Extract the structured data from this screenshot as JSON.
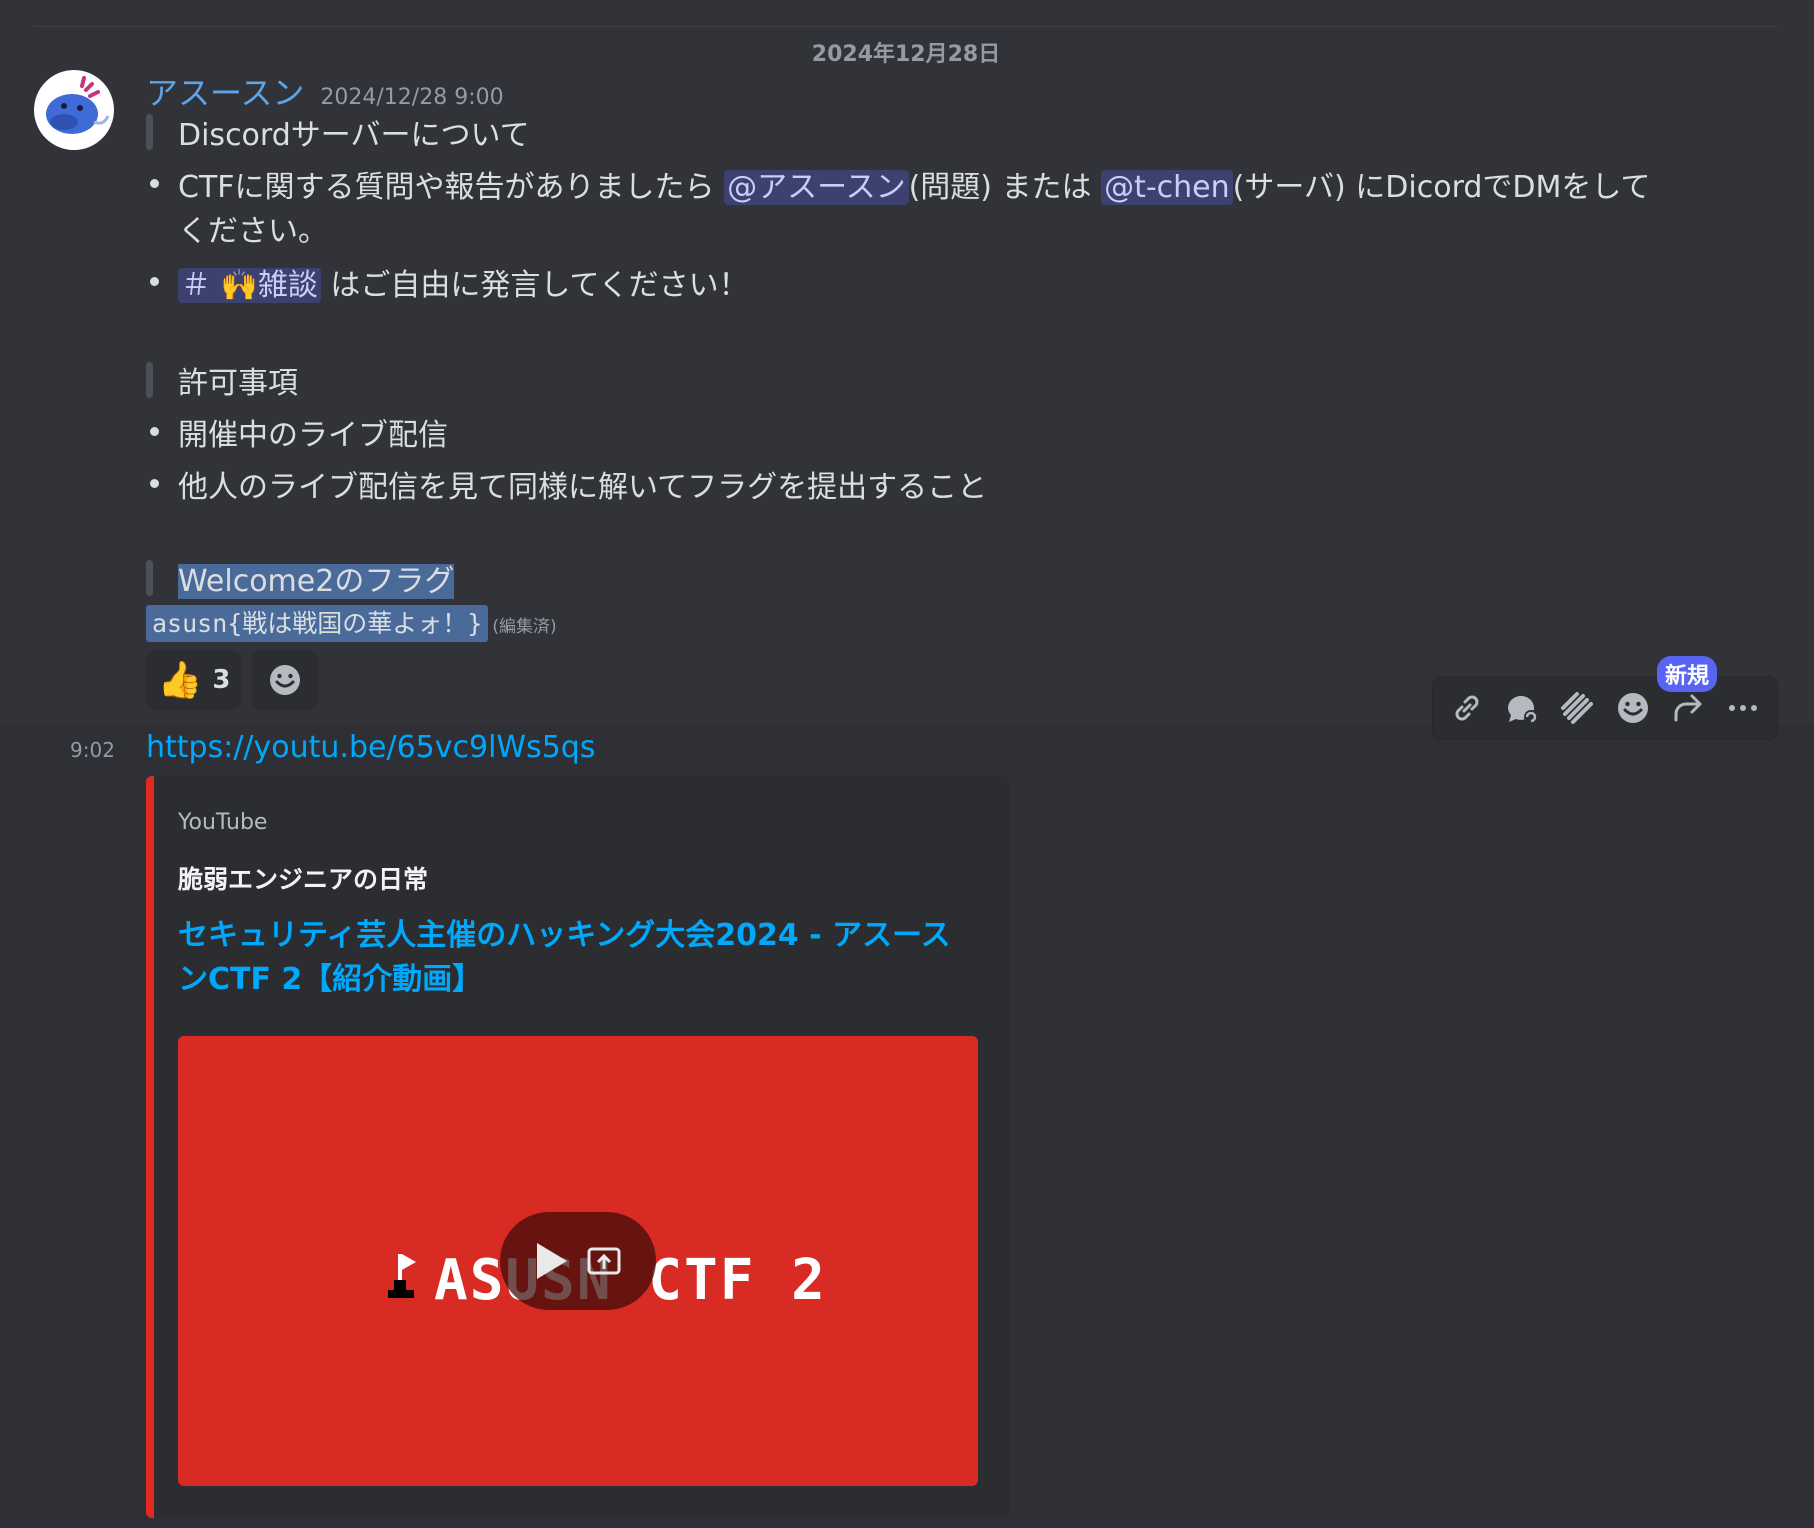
{
  "date_divider": "2024年12月28日",
  "message": {
    "username": "アスースン",
    "timestamp": "2024/12/28 9:00",
    "sections": {
      "intro_heading": "Discordサーバーについて",
      "bullet1_pre": "CTFに関する質問や報告がありましたら ",
      "mention1": "@アスースン",
      "bullet1_mid": "(問題) または ",
      "mention2": "@t-chen",
      "bullet1_post": "(サーバ) にDicordでDMをして",
      "bullet1_cont": "ください。",
      "channel_mention": "＃ 🙌雑談",
      "bullet2_post": " はご自由に発言してください！",
      "allowed_heading": "許可事項",
      "allowed1": "開催中のライブ配信",
      "allowed2": "他人のライブ配信を見て同様に解いてフラグを提出すること",
      "flag_heading": "Welcome2のフラグ",
      "flag_code": "asusn{戦は戦国の華よォ！}",
      "edited": "(編集済)"
    },
    "reactions": [
      {
        "emoji": "👍",
        "count": "3"
      }
    ]
  },
  "toolbar": {
    "new_badge": "新規",
    "icons": [
      "link-icon",
      "thread-reply-icon",
      "sticker-icon",
      "add-reaction-icon",
      "forward-icon",
      "more-icon"
    ]
  },
  "message2": {
    "time": "9:02",
    "link": "https://youtu.be/65vc9lWs5qs",
    "embed": {
      "provider": "YouTube",
      "author": "脆弱エンジニアの日常",
      "title": "セキュリティ芸人主催のハッキング大会2024 - アスースンCTF 2【紹介動画】",
      "thumbnail_text": "ASUSN CTF 2"
    }
  },
  "colors": {
    "background": "#313338",
    "accent_link": "#00a8fc",
    "embed_bar": "#e3281e",
    "thumbnail": "#d72b23",
    "badge": "#5865f2"
  }
}
